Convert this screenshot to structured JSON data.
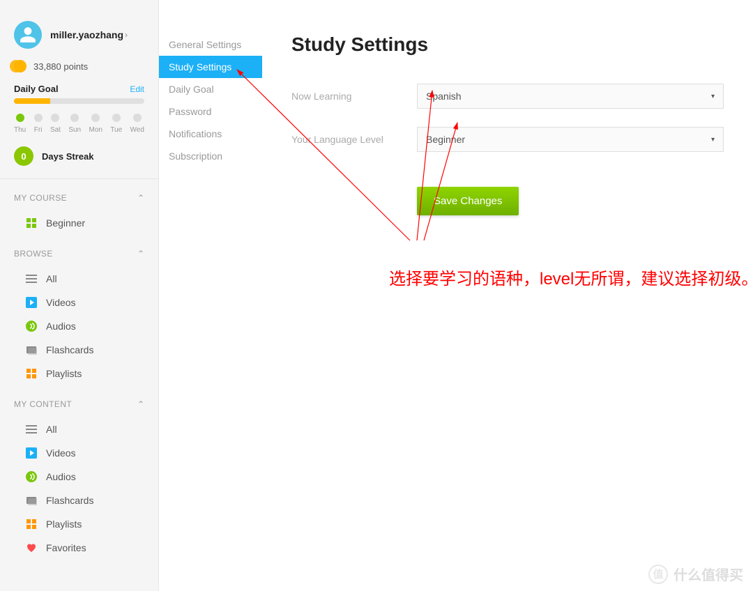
{
  "user": {
    "name": "miller.yaozhang",
    "points_text": "33,880 points"
  },
  "daily_goal": {
    "label": "Daily Goal",
    "edit": "Edit",
    "days": [
      "Thu",
      "Fri",
      "Sat",
      "Sun",
      "Mon",
      "Tue",
      "Wed"
    ],
    "streak_value": "0",
    "streak_label": "Days Streak"
  },
  "sections": {
    "my_course": {
      "title": "MY COURSE",
      "beginner": "Beginner"
    },
    "browse": {
      "title": "BROWSE",
      "all": "All",
      "videos": "Videos",
      "audios": "Audios",
      "flashcards": "Flashcards",
      "playlists": "Playlists"
    },
    "my_content": {
      "title": "MY CONTENT",
      "all": "All",
      "videos": "Videos",
      "audios": "Audios",
      "flashcards": "Flashcards",
      "playlists": "Playlists",
      "favorites": "Favorites"
    }
  },
  "settings_nav": {
    "general": "General Settings",
    "study": "Study Settings",
    "goal": "Daily Goal",
    "password": "Password",
    "notifications": "Notifications",
    "subscription": "Subscription"
  },
  "page": {
    "title": "Study Settings",
    "now_learning_label": "Now Learning",
    "now_learning_value": "Spanish",
    "level_label": "Your Language Level",
    "level_value": "Beginner",
    "save": "Save Changes"
  },
  "annotation": "选择要学习的语种，level无所谓，建议选择初级。",
  "watermark": "什么值得买"
}
